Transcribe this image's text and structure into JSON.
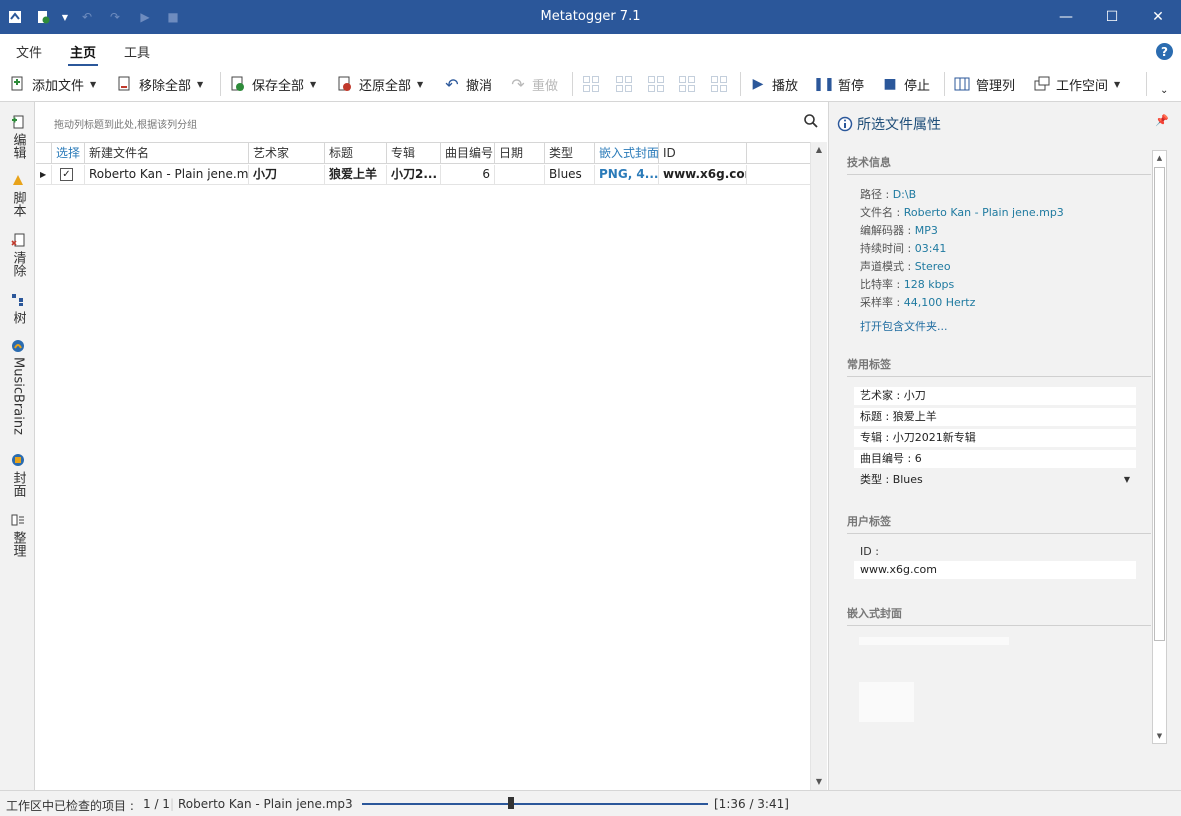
{
  "window": {
    "title": "Metatogger 7.1",
    "minimize_glyph": "—",
    "maximize_glyph": "☐",
    "close_glyph": "✕"
  },
  "ribbon_tabs": [
    {
      "label": "文件"
    },
    {
      "label": "主页",
      "active": true
    },
    {
      "label": "工具"
    }
  ],
  "help": {
    "glyph": "?"
  },
  "toolbar": {
    "add_files": "添加文件",
    "remove_all": "移除全部",
    "save_all": "保存全部",
    "restore_all": "还原全部",
    "undo": "撤消",
    "redo": "重做",
    "play": "播放",
    "pause": "暂停",
    "stop": "停止",
    "manage_columns": "管理列",
    "workspace": "工作空间"
  },
  "sidebar": {
    "items": [
      {
        "label": "编辑",
        "icon": "edit-icon"
      },
      {
        "label": "脚本",
        "icon": "script-icon"
      },
      {
        "label": "清除",
        "icon": "clean-icon"
      },
      {
        "label": "树",
        "icon": "tree-icon"
      },
      {
        "label": "MusicBrainz",
        "icon": "musicbrainz-icon"
      },
      {
        "label": "封面",
        "icon": "cover-icon"
      },
      {
        "label": "整理",
        "icon": "organize-icon"
      }
    ]
  },
  "group_hint": "拖动列标题到此处,根据该列分组",
  "table": {
    "columns": [
      "选择",
      "新建文件名",
      "艺术家",
      "标题",
      "专辑",
      "曲目编号",
      "日期",
      "类型",
      "嵌入式封面",
      "ID"
    ],
    "rows": [
      {
        "checked": "✓",
        "filename": "Roberto Kan - Plain jene.mp3",
        "artist": "小刀",
        "title": "狼爱上羊",
        "album": "小刀2...",
        "track": "6",
        "date": "",
        "genre": "Blues",
        "cover": "PNG, 4...",
        "id": "www.x6g.com"
      }
    ]
  },
  "panel": {
    "title": "所选文件属性",
    "tech_header": "技术信息",
    "tech": [
      {
        "label": "路径 : ",
        "value": "D:\\B"
      },
      {
        "label": "文件名 : ",
        "value": "Roberto Kan - Plain jene.mp3"
      },
      {
        "label": "编解码器 : ",
        "value": "MP3"
      },
      {
        "label": "持续时间 : ",
        "value": "03:41"
      },
      {
        "label": "声道模式 : ",
        "value": "Stereo"
      },
      {
        "label": "比特率 : ",
        "value": "128 kbps"
      },
      {
        "label": "采样率 : ",
        "value": "44,100 Hertz"
      }
    ],
    "open_folder": "打开包含文件夹...",
    "common_header": "常用标签",
    "common": [
      {
        "label": "艺术家 : ",
        "value": "小刀"
      },
      {
        "label": "标题 : ",
        "value": "狼爱上羊"
      },
      {
        "label": "专辑 : ",
        "value": "小刀2021新专辑"
      },
      {
        "label": "曲目编号 : ",
        "value": "6"
      },
      {
        "label": "类型 : ",
        "value": "Blues"
      }
    ],
    "user_header": "用户标签",
    "user_label": "ID :",
    "user_value": "www.x6g.com",
    "cover_header": "嵌入式封面"
  },
  "status": {
    "checked_label": "工作区中已检查的项目 : ",
    "checked_count": "1 / 1",
    "now_playing": "Roberto Kan - Plain jene.mp3",
    "time": "[1:36 / 3:41]",
    "progress": 0.43
  }
}
